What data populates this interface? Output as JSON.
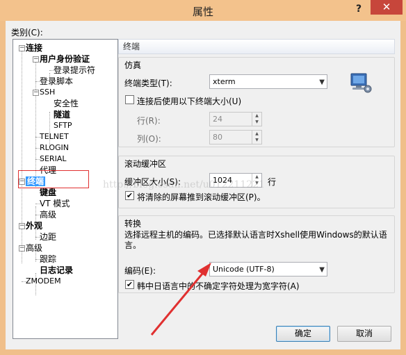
{
  "window": {
    "title": "属性",
    "help_label": "?",
    "close_label": "✕"
  },
  "category_label": "类别(C):",
  "tree": {
    "connection": "连接",
    "user_auth": "用户身份验证",
    "login_prompt": "登录提示符",
    "login_script": "登录脚本",
    "ssh": "SSH",
    "security": "安全性",
    "tunnel": "隧道",
    "sftp": "SFTP",
    "telnet": "TELNET",
    "rlogin": "RLOGIN",
    "serial": "SERIAL",
    "proxy": "代理",
    "terminal": "终端",
    "keyboard": "键盘",
    "vt_mode": "VT 模式",
    "advanced": "高级",
    "appearance": "外观",
    "margin": "边距",
    "advanced2": "高级",
    "trace": "跟踪",
    "logging": "日志记录",
    "zmodem": "ZMODEM"
  },
  "panel": {
    "header": "终端",
    "emulation": {
      "title": "仿真",
      "terminal_type_label": "终端类型(T):",
      "terminal_type_value": "xterm",
      "use_size_label": "连接后使用以下终端大小(U)",
      "rows_label": "行(R):",
      "rows_value": "24",
      "cols_label": "列(O):",
      "cols_value": "80"
    },
    "scroll": {
      "title": "滚动缓冲区",
      "size_label": "缓冲区大小(S):",
      "size_value": "1024",
      "unit": "行",
      "push_label": "将清除的屏幕推到滚动缓冲区(P)。"
    },
    "convert": {
      "title": "转换",
      "description": "选择远程主机的编码。已选择默认语言时Xshell使用Windows的默认语言。",
      "encoding_label": "编码(E):",
      "encoding_value": "Unicode (UTF-8)",
      "cjk_label": "韩中日语言中的不确定字符处理为宽字符(A)"
    }
  },
  "buttons": {
    "ok": "确定",
    "cancel": "取消"
  },
  "watermark": "http://blog.csdn.net/u012211221",
  "colors": {
    "title_bar": "#f3c28c",
    "close": "#c7463b",
    "selection": "#3399ff",
    "arrow": "#e03030"
  }
}
